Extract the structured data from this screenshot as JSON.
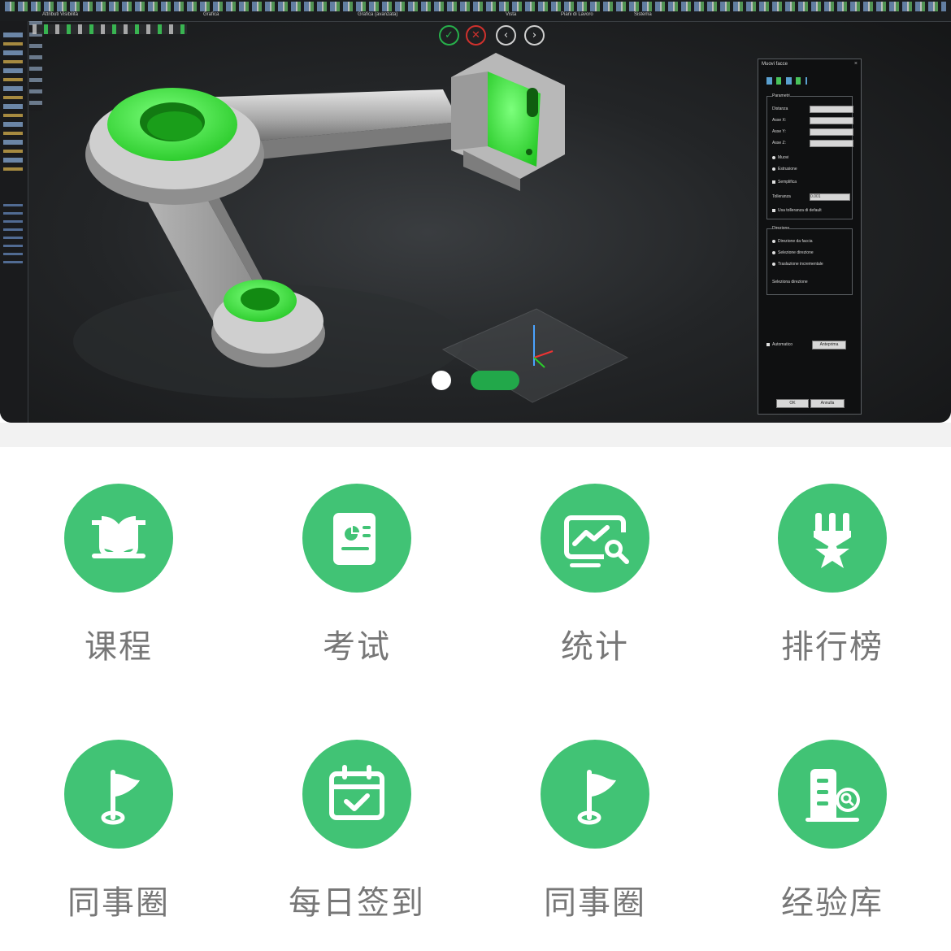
{
  "banner": {
    "cad_toolbar_groups": [
      "Attributi Visibilità",
      "Grafica",
      "Grafica (avanzata)",
      "Vista",
      "Piani di Lavoro",
      "Sistema"
    ],
    "cad_panel": {
      "title": "Muovi facce",
      "section_params": "Parametri",
      "distance_label": "Distanza",
      "axis_x": "Asse X:",
      "axis_y": "Asse Y:",
      "axis_z": "Asse Z:",
      "opt_move": "Muovi",
      "opt_extrude": "Estrusione",
      "opt_simplify": "Semplifica",
      "tolerance_label": "Tolleranza",
      "tolerance_value": "0.001",
      "use_default_tol": "Usa tolleranza di default",
      "section_direction": "Direzione",
      "dir_face": "Direzione da faccia",
      "dir_select": "Selezione direzione",
      "dir_incremental": "Traslazione incrementale",
      "select_direction": "Seleziona direzione",
      "automatic": "Automatico",
      "anteprima": "Anteprima",
      "ok": "OK",
      "cancel": "Annulla"
    },
    "active_slide": 2,
    "slide_count": 2
  },
  "menu": [
    {
      "label": "课程",
      "icon": "book-icon"
    },
    {
      "label": "考试",
      "icon": "exam-paper-icon"
    },
    {
      "label": "统计",
      "icon": "statistics-chart-icon"
    },
    {
      "label": "排行榜",
      "icon": "medal-ranking-icon"
    },
    {
      "label": "同事圈",
      "icon": "flag-icon"
    },
    {
      "label": "每日签到",
      "icon": "calendar-check-icon"
    },
    {
      "label": "同事圈",
      "icon": "flag-icon"
    },
    {
      "label": "经验库",
      "icon": "building-search-icon"
    }
  ],
  "colors": {
    "accent": "#41c375",
    "label": "#777777",
    "carousel_active": "#22a84a"
  }
}
